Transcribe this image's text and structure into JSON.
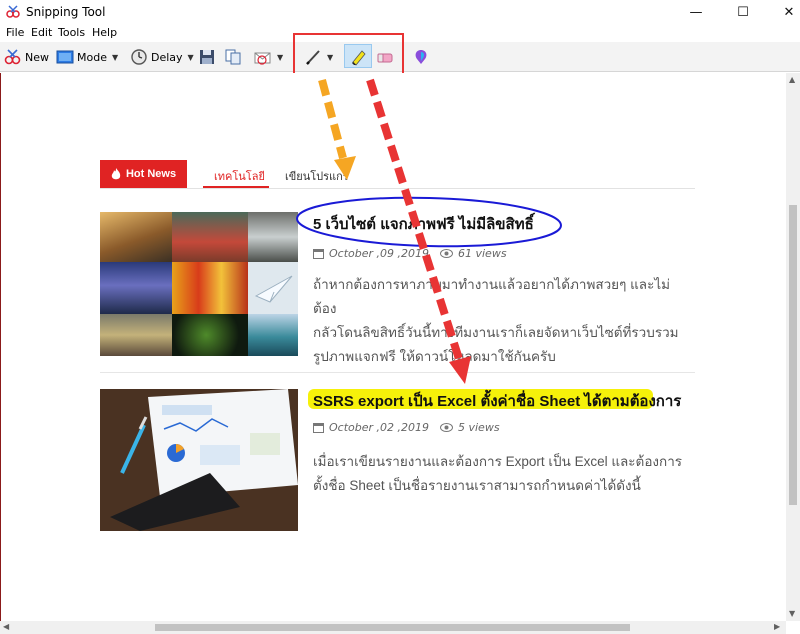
{
  "window": {
    "title": "Snipping Tool",
    "minimize_glyph": "—",
    "maximize_glyph": "☐",
    "close_glyph": "✕"
  },
  "menu": [
    "File",
    "Edit",
    "Tools",
    "Help"
  ],
  "toolbar": {
    "new_label": "New",
    "mode_label": "Mode",
    "delay_label": "Delay",
    "icons": [
      "new-snip-icon",
      "mode-icon",
      "delay-clock-icon",
      "save-icon",
      "copy-icon",
      "send-email-icon",
      "pen-icon",
      "highlighter-icon",
      "eraser-icon",
      "paint3d-icon"
    ]
  },
  "page": {
    "hot_news_label": "Hot News",
    "tabs": [
      "เทคโนโลยี",
      "เขียนโปรแกร"
    ],
    "posts": [
      {
        "title": "5 เว็บไซต์ แจกภาพฟรี ไม่มีลิขสิทธิ์",
        "date": "October ,09 ,2019",
        "views": "61 views",
        "excerpt_lines": [
          "ถ้าหากต้องการหาภาพมาทำงานแล้วอยากได้ภาพสวยๆ และไม่ต้อง",
          "กลัวโดนลิขสิทธิ์วันนี้ทางทีมงานเราก็เลยจัดหาเว็บไซต์ที่รวบรวม",
          "รูปภาพแจกฟรี ให้ดาวน์โหลดมาใช้กันครับ"
        ]
      },
      {
        "title": "SSRS export เป็น Excel ตั้งค่าชื่อ Sheet ได้ตามต้องการ",
        "date": "October ,02 ,2019",
        "views": "5 views",
        "excerpt_lines": [
          "เมื่อเราเขียนรายงานและต้องการ Export เป็น Excel และต้องการ",
          "ตั้งชื่อ Sheet เป็นชื่อรายงานเราสามารถกำหนดค่าได้ดังนี้"
        ]
      }
    ]
  },
  "colors": {
    "accent_red": "#e02323",
    "annotation_red": "#e83434",
    "annotation_orange": "#f5a623",
    "annotation_blue": "#1a1ad6",
    "highlight_yellow": "#f6f10a"
  }
}
